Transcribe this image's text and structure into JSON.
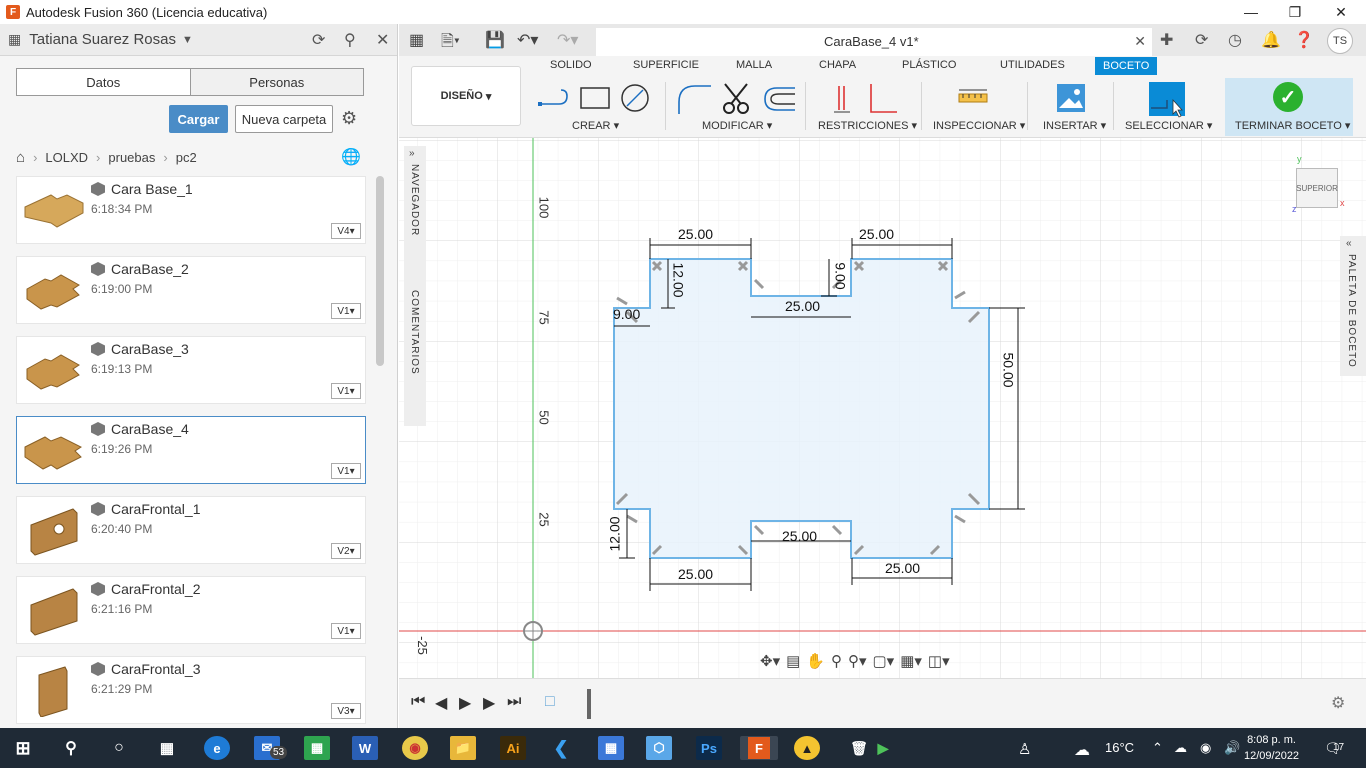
{
  "window": {
    "app_icon": "F",
    "title": "Autodesk Fusion 360 (Licencia educativa)",
    "minimize_icon": "minimize-icon",
    "maximize_icon": "maximize-icon",
    "close_icon": "close-icon"
  },
  "data_panel": {
    "user_name": "Tatiana Suarez Rosas",
    "tabs": [
      "Datos",
      "Personas"
    ],
    "upload_label": "Cargar",
    "new_folder_label": "Nueva carpeta",
    "breadcrumb": [
      "LOLXD",
      "pruebas",
      "pc2"
    ],
    "files": [
      {
        "name": "Cara Base_1",
        "time": "6:18:34 PM",
        "version": "V4"
      },
      {
        "name": "CaraBase_2",
        "time": "6:19:00 PM",
        "version": "V1"
      },
      {
        "name": "CaraBase_3",
        "time": "6:19:13 PM",
        "version": "V1"
      },
      {
        "name": "CaraBase_4",
        "time": "6:19:26 PM",
        "version": "V1",
        "selected": true
      },
      {
        "name": "CaraFrontal_1",
        "time": "6:20:40 PM",
        "version": "V2"
      },
      {
        "name": "CaraFrontal_2",
        "time": "6:21:16 PM",
        "version": "V1"
      },
      {
        "name": "CaraFrontal_3",
        "time": "6:21:29 PM",
        "version": "V3"
      }
    ]
  },
  "document_tab": {
    "title": "CaraBase_4 v1*",
    "user_initials": "TS"
  },
  "ribbon": {
    "workspace": "DISEÑO",
    "tabs": [
      "SOLIDO",
      "SUPERFICIE",
      "MALLA",
      "CHAPA",
      "PLÁSTICO",
      "UTILIDADES",
      "BOCETO"
    ],
    "active_tab": "BOCETO",
    "groups": [
      "CREAR",
      "MODIFICAR",
      "RESTRICCIONES",
      "INSPECCIONAR",
      "INSERTAR",
      "SELECCIONAR"
    ],
    "finish_label": "TERMINAR BOCETO"
  },
  "canvas": {
    "navigator_label": "NAVEGADOR",
    "comments_label": "COMENTARIOS",
    "palette_label": "PALETA DE BOCETO",
    "viewcube_label": "SUPERIOR",
    "axis_labels": [
      "100",
      "75",
      "50",
      "25",
      "-25"
    ],
    "dimensions": [
      "25.00",
      "25.00",
      "12.00",
      "9.00",
      "25.00",
      "9.00",
      "50.00",
      "12.00",
      "25.00",
      "25.00",
      "25.00"
    ]
  },
  "taskbar": {
    "temperature": "16°C",
    "time": "8:08 p. m.",
    "date": "12/09/2022",
    "mail_badge": "53",
    "notif_badge": "17"
  },
  "colors": {
    "accent": "#0a8bd6",
    "sketch_line": "#6eb4e6",
    "sketch_fill": "#e8f2fb",
    "x_axis": "#e04848",
    "y_axis": "#4ec25a"
  }
}
